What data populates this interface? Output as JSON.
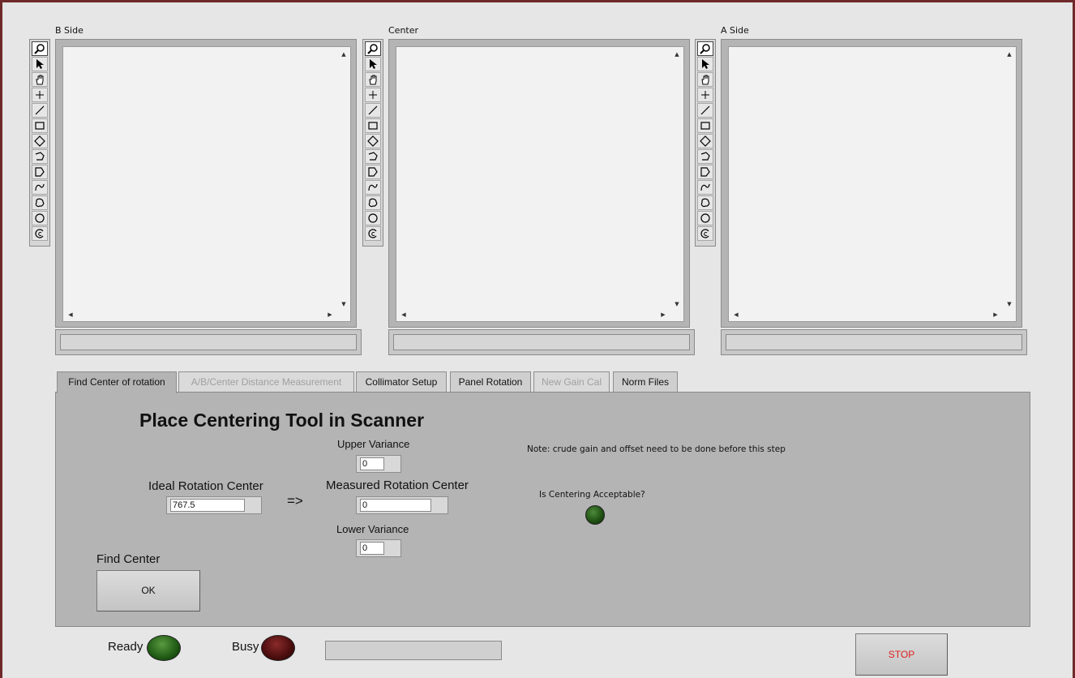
{
  "displays": [
    {
      "title": "B Side"
    },
    {
      "title": "Center"
    },
    {
      "title": "A Side"
    }
  ],
  "tools": [
    "zoom-icon",
    "pointer-icon",
    "pan-hand-icon",
    "point-crosshair-icon",
    "line-icon",
    "rectangle-icon",
    "rotated-rectangle-icon",
    "annulus-icon",
    "polygon-icon",
    "freehand-icon",
    "freehand-region-icon",
    "oval-icon",
    "broken-annulus-icon"
  ],
  "tabs": [
    {
      "label": "Find Center of rotation",
      "state": "active"
    },
    {
      "label": "A/B/Center Distance Measurement",
      "state": "disabled"
    },
    {
      "label": "Collimator Setup",
      "state": "normal"
    },
    {
      "label": "Panel Rotation",
      "state": "normal"
    },
    {
      "label": "New Gain Cal",
      "state": "disabled"
    },
    {
      "label": "Norm Files",
      "state": "normal"
    }
  ],
  "panel": {
    "heading": "Place Centering Tool in Scanner",
    "note": "Note: crude gain and offset need to be done before this step",
    "ideal_label": "Ideal Rotation Center",
    "ideal_value": "767.5",
    "arrow": "=>",
    "upper_label": "Upper Variance",
    "upper_value": "0",
    "measured_label": "Measured Rotation Center",
    "measured_value": "0",
    "lower_label": "Lower Variance",
    "lower_value": "0",
    "acceptable_label": "Is Centering Acceptable?",
    "find_center_label": "Find Center",
    "ok_button": "OK"
  },
  "footer": {
    "ready_label": "Ready",
    "busy_label": "Busy",
    "stop_button": "STOP"
  },
  "colors": {
    "stop_text": "#e02020",
    "ready_led": "#1f5a14",
    "busy_led": "#4a0d0d",
    "accept_led": "#1d4d12"
  }
}
